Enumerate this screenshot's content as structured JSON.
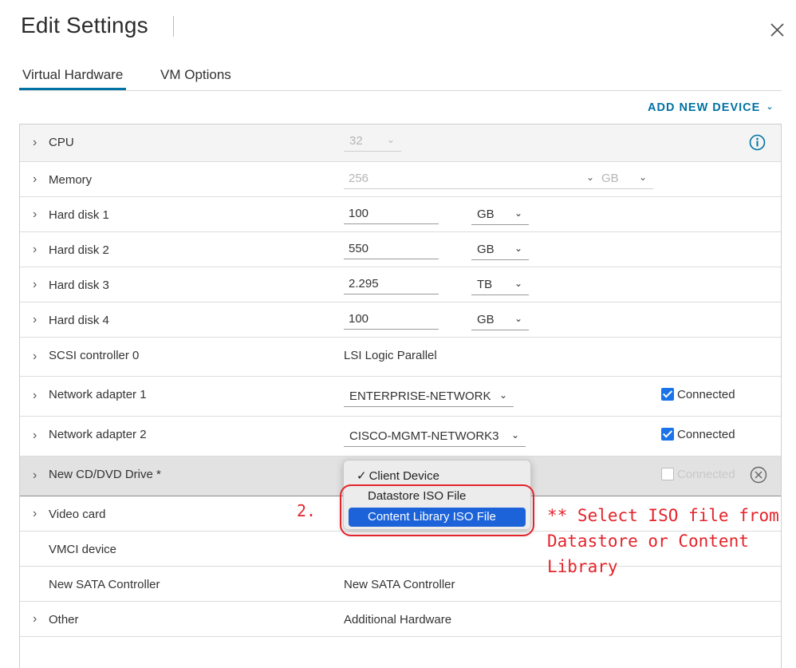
{
  "header": {
    "title": "Edit Settings",
    "close_icon": "close-icon"
  },
  "tabs": [
    {
      "label": "Virtual Hardware",
      "active": true
    },
    {
      "label": "VM Options",
      "active": false
    }
  ],
  "add_new_device": {
    "label": "ADD NEW DEVICE",
    "icon": "chevron-down-icon"
  },
  "accent_color": "#0072a3",
  "rows": {
    "cpu": {
      "label": "CPU",
      "value": "32",
      "info_icon": "info-icon"
    },
    "memory": {
      "label": "Memory",
      "value": "256",
      "unit": "GB"
    },
    "hard_disk_1": {
      "label": "Hard disk 1",
      "value": "100",
      "unit": "GB"
    },
    "hard_disk_2": {
      "label": "Hard disk 2",
      "value": "550",
      "unit": "GB"
    },
    "hard_disk_3": {
      "label": "Hard disk 3",
      "value": "2.295",
      "unit": "TB"
    },
    "hard_disk_4": {
      "label": "Hard disk 4",
      "value": "100",
      "unit": "GB"
    },
    "scsi_controller": {
      "label": "SCSI controller 0",
      "value": "LSI Logic Parallel"
    },
    "network_adapter_1": {
      "label": "Network adapter 1",
      "value": "ENTERPRISE-NETWORK",
      "connected_label": "Connected",
      "connected": true
    },
    "network_adapter_2": {
      "label": "Network adapter 2",
      "value": "CISCO-MGMT-NETWORK3",
      "connected_label": "Connected",
      "connected": true
    },
    "cd_dvd": {
      "label": "New CD/DVD Drive *",
      "connected_label": "Connected",
      "connected": false
    },
    "video_card": {
      "label": "Video card"
    },
    "vmci": {
      "label": "VMCI device"
    },
    "sata": {
      "label": "New SATA Controller",
      "value": "New SATA Controller"
    },
    "other": {
      "label": "Other",
      "value": "Additional Hardware"
    }
  },
  "cd_dropdown": {
    "options": [
      "Client Device",
      "Datastore ISO File",
      "Content Library ISO File"
    ],
    "selected": "Client Device",
    "highlighted": "Content Library ISO File",
    "check_mark": "✓"
  },
  "annotations": {
    "step": "2.",
    "note_line1": "** Select ISO file from",
    "note_line2": "Datastore or Content",
    "note_line3": "Library",
    "color": "#e3242b"
  }
}
